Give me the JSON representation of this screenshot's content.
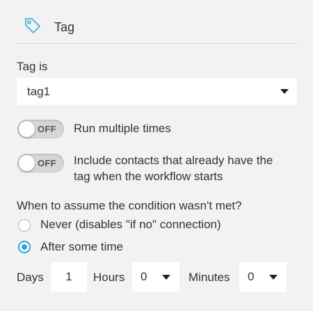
{
  "header": {
    "title": "Tag",
    "icon": "tag-icon"
  },
  "tag_field": {
    "label": "Tag is",
    "value": "tag1"
  },
  "toggles": [
    {
      "state_text": "OFF",
      "label": "Run multiple times"
    },
    {
      "state_text": "OFF",
      "label_line1": "Include contacts that already have the",
      "label_line2": "tag when the workflow starts"
    }
  ],
  "condition": {
    "question": "When to assume the condition wasn't met?",
    "options": [
      {
        "label": "Never (disables \"if no\" connection)",
        "selected": false
      },
      {
        "label": "After some time",
        "selected": true
      }
    ]
  },
  "timing": {
    "days_label": "Days",
    "days_value": "1",
    "hours_label": "Hours",
    "hours_value": "0",
    "minutes_label": "Minutes",
    "minutes_value": "0"
  },
  "colors": {
    "accent": "#2aa6e0",
    "icon_color": "#3fb3e6",
    "background": "#f2f2f2"
  }
}
